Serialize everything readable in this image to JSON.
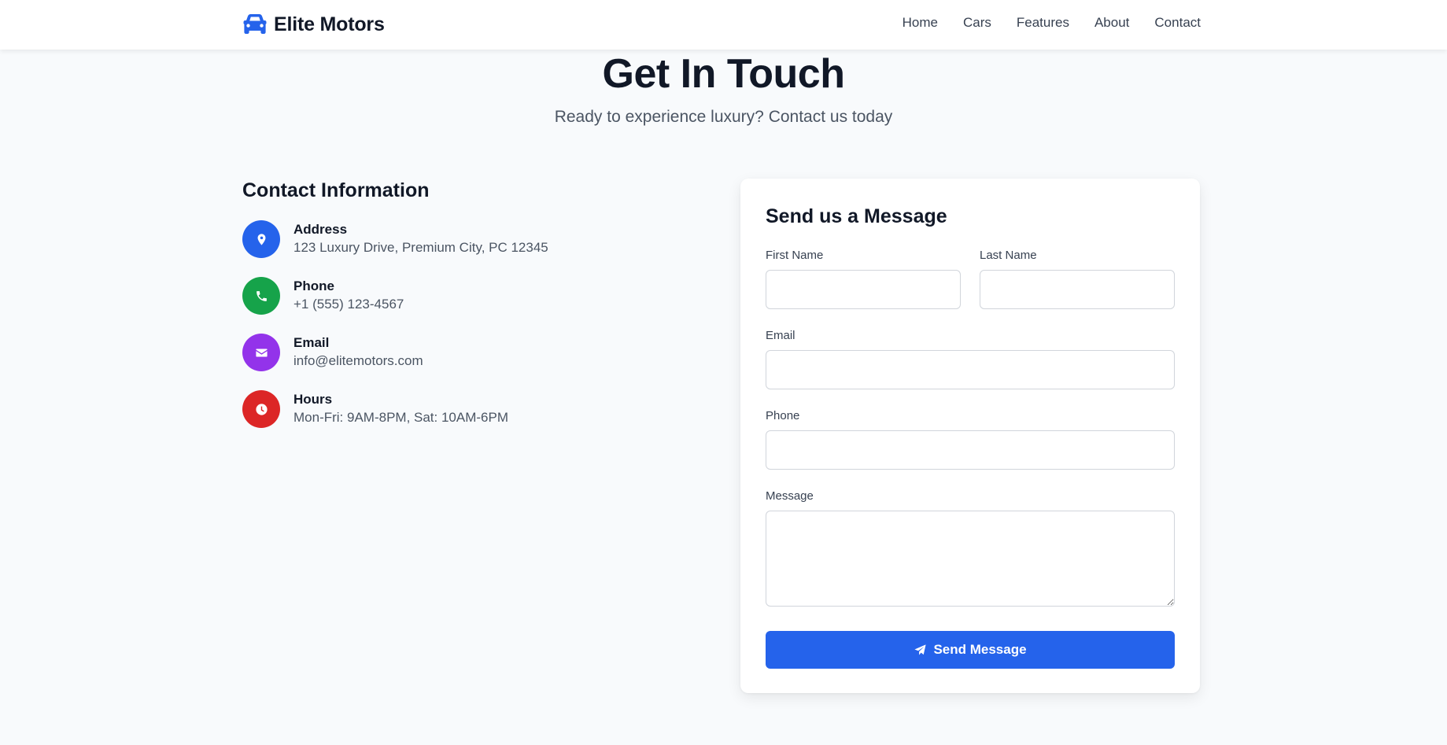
{
  "brand": {
    "name": "Elite Motors",
    "icon": "car-icon",
    "color": "#2563eb"
  },
  "nav": {
    "links": [
      "Home",
      "Cars",
      "Features",
      "About",
      "Contact"
    ]
  },
  "hero": {
    "title": "Get In Touch",
    "subtitle": "Ready to experience luxury? Contact us today"
  },
  "contact_info": {
    "heading": "Contact Information",
    "items": [
      {
        "label": "Address",
        "value": "123 Luxury Drive, Premium City, PC 12345",
        "icon": "map-pin-icon",
        "color": "#2563eb"
      },
      {
        "label": "Phone",
        "value": "+1 (555) 123-4567",
        "icon": "phone-icon",
        "color": "#16a34a"
      },
      {
        "label": "Email",
        "value": "info@elitemotors.com",
        "icon": "envelope-icon",
        "color": "#9333ea"
      },
      {
        "label": "Hours",
        "value": "Mon-Fri: 9AM-8PM, Sat: 10AM-6PM",
        "icon": "clock-icon",
        "color": "#dc2626"
      }
    ]
  },
  "form": {
    "title": "Send us a Message",
    "first_name": {
      "label": "First Name",
      "value": ""
    },
    "last_name": {
      "label": "Last Name",
      "value": ""
    },
    "email": {
      "label": "Email",
      "value": ""
    },
    "phone": {
      "label": "Phone",
      "value": ""
    },
    "message": {
      "label": "Message",
      "value": ""
    },
    "submit": {
      "label": "Send Message",
      "icon": "paper-plane-icon",
      "color": "#2563eb"
    }
  }
}
